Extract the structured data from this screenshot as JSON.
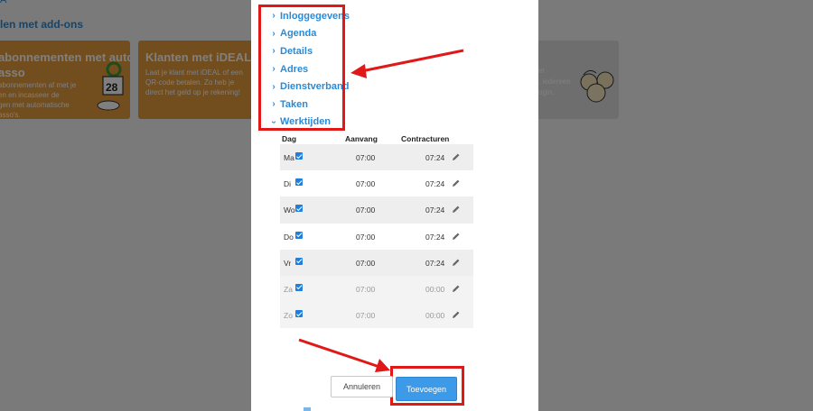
{
  "background": {
    "top_link": "A",
    "heading": "len met add-ons",
    "cards": [
      {
        "title": "abonnementen met autom.\nasso",
        "desc": "abonnementen af met je\nen en incasseer de\ngen met automatische\nasso's.",
        "color": "#e59a3a"
      },
      {
        "title": "Klanten met iDEAL laten b",
        "desc": "Laat je klant met iDEAL of een\nQR-code betalen. Zo heb je\ndirect het geld op je rekening!",
        "color": "#e59a3a"
      },
      {
        "desc": "et\n, iedereen\nogin.",
        "color": "#dcdcdc"
      }
    ]
  },
  "modal": {
    "sections": [
      {
        "label": "Inloggegevens",
        "icon": "chevron-right-icon"
      },
      {
        "label": "Agenda",
        "icon": "chevron-right-icon"
      },
      {
        "label": "Details",
        "icon": "chevron-right-icon"
      },
      {
        "label": "Adres",
        "icon": "chevron-right-icon"
      },
      {
        "label": "Dienstverband",
        "icon": "chevron-right-icon"
      },
      {
        "label": "Taken",
        "icon": "chevron-right-icon"
      },
      {
        "label": "Werktijden",
        "icon": "chevron-down-icon"
      }
    ],
    "table": {
      "headers": {
        "day": "Dag",
        "start": "Aanvang",
        "hours": "Contracturen"
      },
      "rows": [
        {
          "day": "Ma",
          "checked": true,
          "start": "07:00",
          "hours": "07:24"
        },
        {
          "day": "Di",
          "checked": true,
          "start": "07:00",
          "hours": "07:24"
        },
        {
          "day": "Wo",
          "checked": true,
          "start": "07:00",
          "hours": "07:24"
        },
        {
          "day": "Do",
          "checked": true,
          "start": "07:00",
          "hours": "07:24"
        },
        {
          "day": "Vr",
          "checked": true,
          "start": "07:00",
          "hours": "07:24"
        },
        {
          "day": "Za",
          "checked": true,
          "start": "07:00",
          "hours": "00:00"
        },
        {
          "day": "Zo",
          "checked": true,
          "start": "07:00",
          "hours": "00:00"
        }
      ]
    },
    "buttons": {
      "cancel": "Annuleren",
      "add": "Toevoegen"
    }
  },
  "colors": {
    "accent": "#2a8ad6",
    "primary_button": "#3d9ae8",
    "annotation": "#e01818"
  }
}
